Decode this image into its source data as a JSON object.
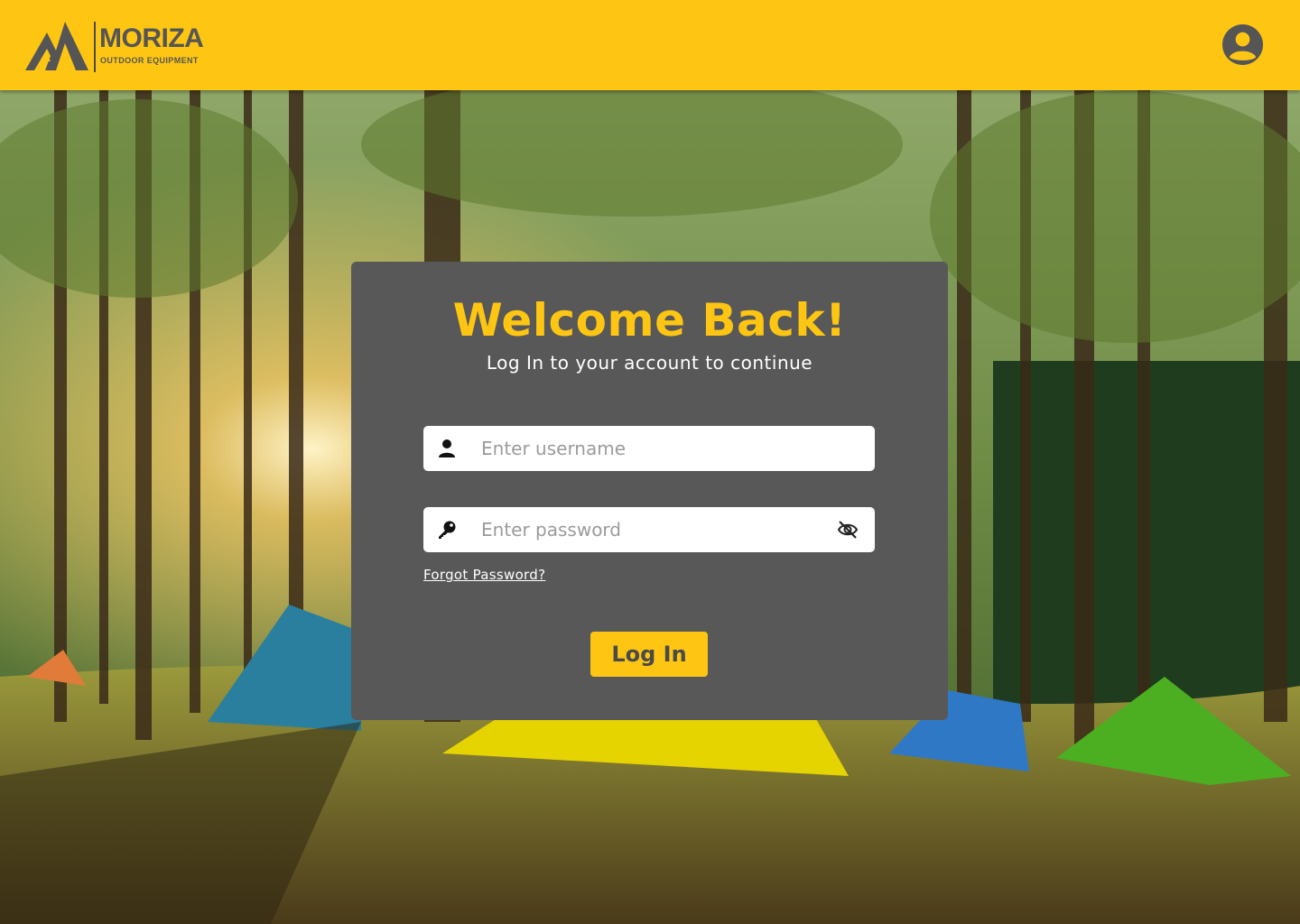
{
  "brand": {
    "name": "MORIZA",
    "tagline": "OUTDOOR EQUIPMENT",
    "primary_color": "#fec613",
    "text_color": "#555555"
  },
  "header": {
    "account_icon": "user-circle-icon"
  },
  "login": {
    "title": "Welcome Back!",
    "subtitle": "Log In to your account to continue",
    "username": {
      "icon": "user-icon",
      "placeholder": "Enter username",
      "value": ""
    },
    "password": {
      "icon": "key-icon",
      "placeholder": "Enter password",
      "value": "",
      "toggle_icon": "eye-off-icon"
    },
    "forgot_label": "Forgot Password?",
    "submit_label": "Log In"
  },
  "background": {
    "scene": "forest-campsite-image"
  }
}
